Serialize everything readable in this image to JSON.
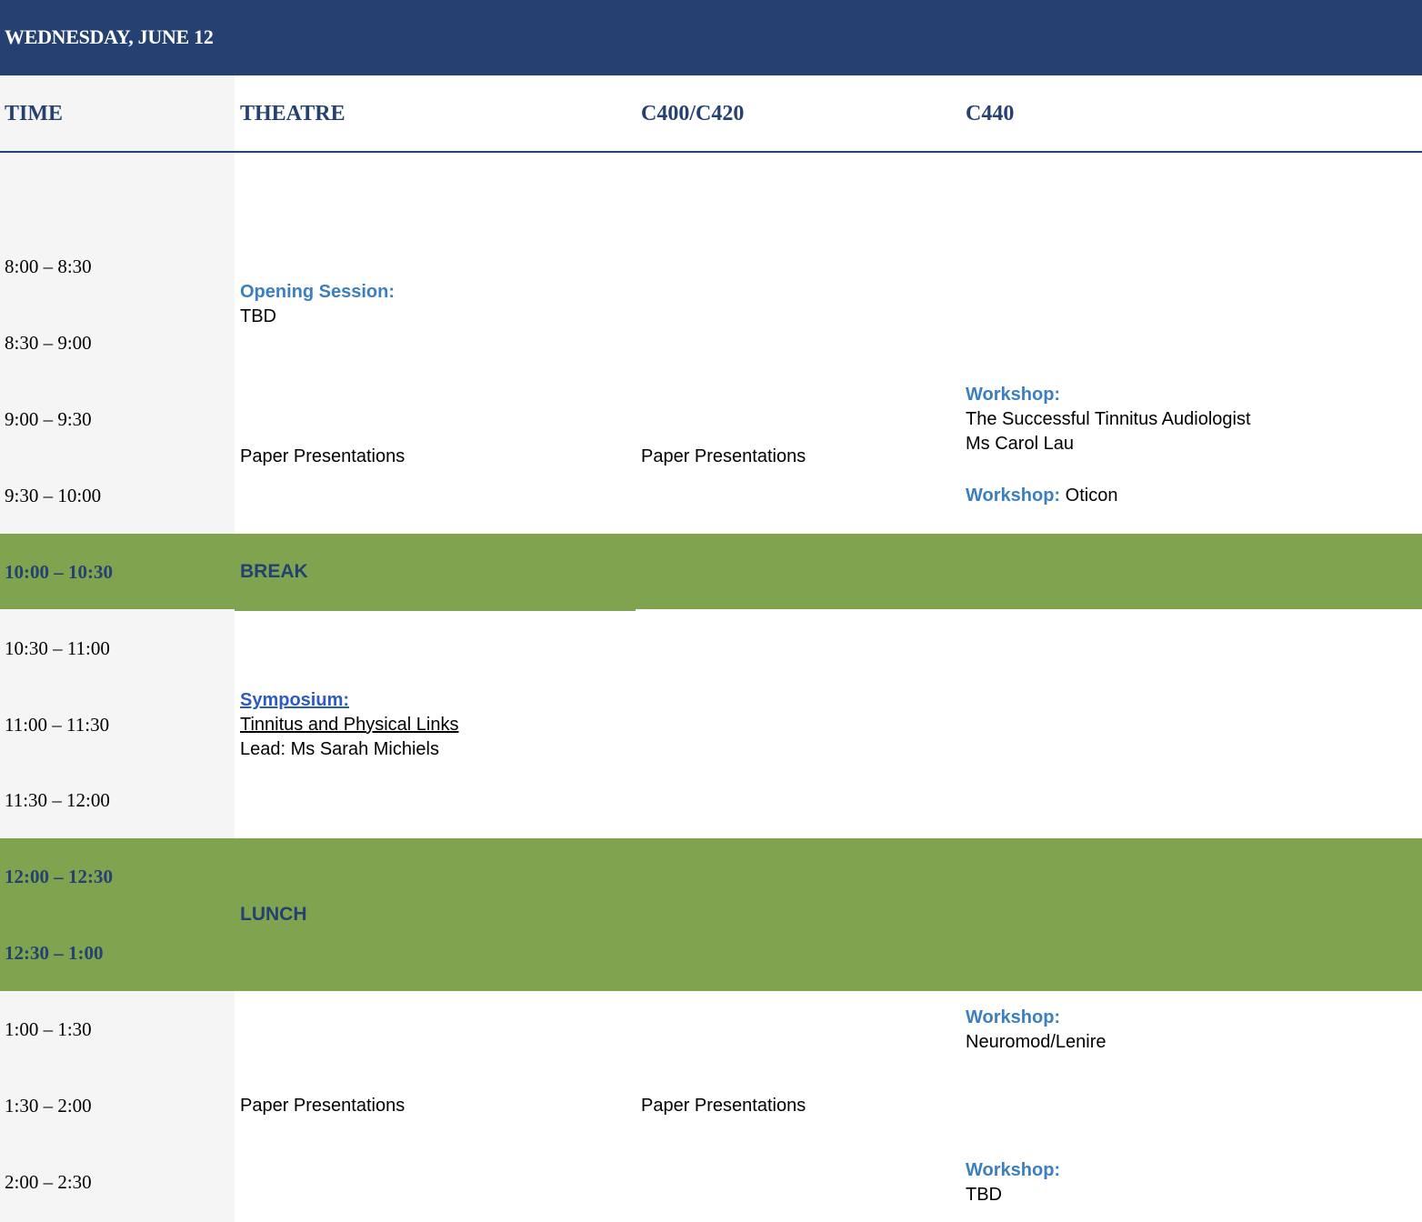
{
  "header": {
    "title": "WEDNESDAY, JUNE 12"
  },
  "columns": {
    "time": "TIME",
    "theatre": "THEATRE",
    "c400": "C400/C420",
    "c440": "C440"
  },
  "colors": {
    "header_bg": "#244171",
    "break_band": "#7fa34f",
    "label_blue": "#3b7fc1",
    "time_column_bg": "#f5f5f5"
  },
  "times": [
    "8:00 – 8:30",
    "8:30 – 9:00",
    "9:00 – 9:30",
    "9:30 – 10:00",
    "10:00 – 10:30",
    "10:30 – 11:00",
    "11:00 – 11:30",
    "11:30 – 12:00",
    "12:00 – 12:30",
    "12:30 – 1:00",
    "1:00 – 1:30",
    "1:30 – 2:00",
    "2:00 – 2:30"
  ],
  "theatre": {
    "opening": {
      "label": "Opening Session:",
      "text": "TBD"
    },
    "paper1": "Paper Presentations",
    "break_label": "BREAK",
    "symposium": {
      "label": "Symposium:",
      "title": "Tinnitus and Physical Links",
      "lead": "Lead: Ms Sarah Michiels"
    },
    "lunch_label": "LUNCH",
    "paper2": "Paper Presentations"
  },
  "c400": {
    "paper1": "Paper Presentations",
    "paper2": "Paper Presentations"
  },
  "c440": {
    "workshop1": {
      "label": "Workshop:",
      "line1": "The Successful Tinnitus Audiologist",
      "line2": "Ms Carol Lau"
    },
    "workshop2": {
      "label": "Workshop:",
      "text": "Oticon"
    },
    "workshop3": {
      "label": "Workshop:",
      "text": "Neuromod/Lenire"
    },
    "workshop4": {
      "label": "Workshop:",
      "text": "TBD"
    }
  }
}
